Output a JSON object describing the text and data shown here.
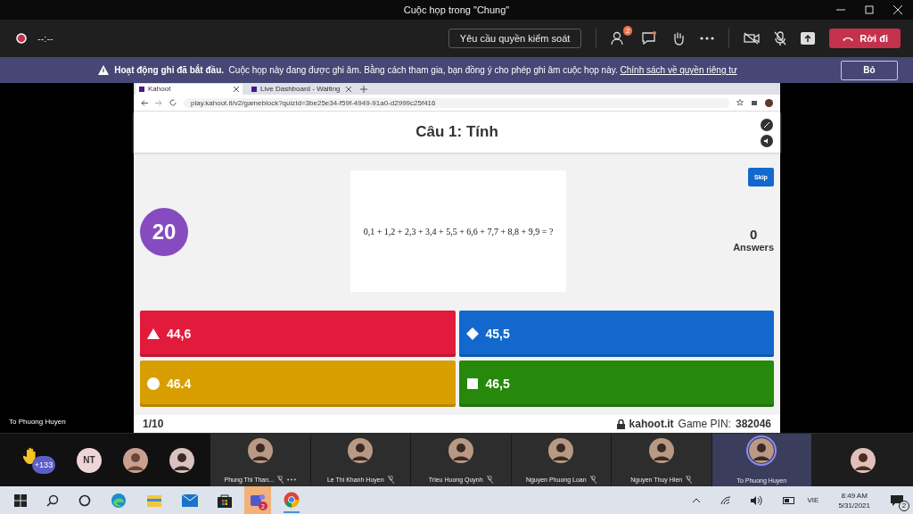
{
  "window": {
    "title": "Cuộc họp trong \"Chung\""
  },
  "toolbar": {
    "timer": "--:--",
    "control_request": "Yêu cầu quyền kiểm soát",
    "people_badge": "2",
    "leave": "Rời đi"
  },
  "banner": {
    "bold": "Hoạt động ghi đã bắt đầu.",
    "text": "Cuộc họp này đang được ghi âm. Bằng cách tham gia, bạn đồng ý cho phép ghi âm cuộc họp này.",
    "link": "Chính sách về quyền riêng tư",
    "dismiss": "Bỏ"
  },
  "browser": {
    "tabs": [
      {
        "label": "Kahoot",
        "selected": true
      },
      {
        "label": "Live Dashboard - Waiting",
        "selected": false
      }
    ],
    "url": "play.kahoot.it/v2/gameblock?quizId=3be25e34-f59f-4949-91a0-d2999c25f416"
  },
  "kahoot": {
    "title": "Câu 1: Tính",
    "skip": "Skip",
    "timer": "20",
    "question": "0,1 + 1,2 + 2,3 + 3,4 + 5,5 + 6,6 + 7,7 + 8,8 + 9,9 = ?",
    "answers_count": "0",
    "answers_label": "Answers",
    "options": [
      {
        "kind": "triangle",
        "text": "44,6",
        "color": "#e21b3c"
      },
      {
        "kind": "diamond",
        "text": "45,5",
        "color": "#1368ce"
      },
      {
        "kind": "circle",
        "text": "46.4",
        "color": "#d89e00"
      },
      {
        "kind": "square",
        "text": "46,5",
        "color": "#26890c"
      }
    ],
    "progress": "1/10",
    "brand": "kahoot.it",
    "pin_label": "Game PIN:",
    "pin": "382046"
  },
  "presenter_label": "To Phuong Huyen",
  "roster": {
    "raised_count": "+133",
    "initials": "NT"
  },
  "participants": [
    {
      "name": "Phung Thi Than...",
      "muted": true,
      "more": true,
      "speaking": false
    },
    {
      "name": "Le Thi Khanh Huyen",
      "muted": true,
      "more": false,
      "speaking": false
    },
    {
      "name": "Trieu Huong Quynh",
      "muted": true,
      "more": false,
      "speaking": false
    },
    {
      "name": "Nguyen Phuong Loan",
      "muted": true,
      "more": false,
      "speaking": false
    },
    {
      "name": "Nguyen Thuy Hien",
      "muted": true,
      "more": false,
      "speaking": false
    },
    {
      "name": "To Phuong Huyen",
      "muted": false,
      "more": false,
      "speaking": true
    }
  ],
  "taskbar": {
    "teams_badge": "2",
    "language": "VIE",
    "time": "8:49 AM",
    "date": "5/31/2021",
    "notifications": "2"
  }
}
